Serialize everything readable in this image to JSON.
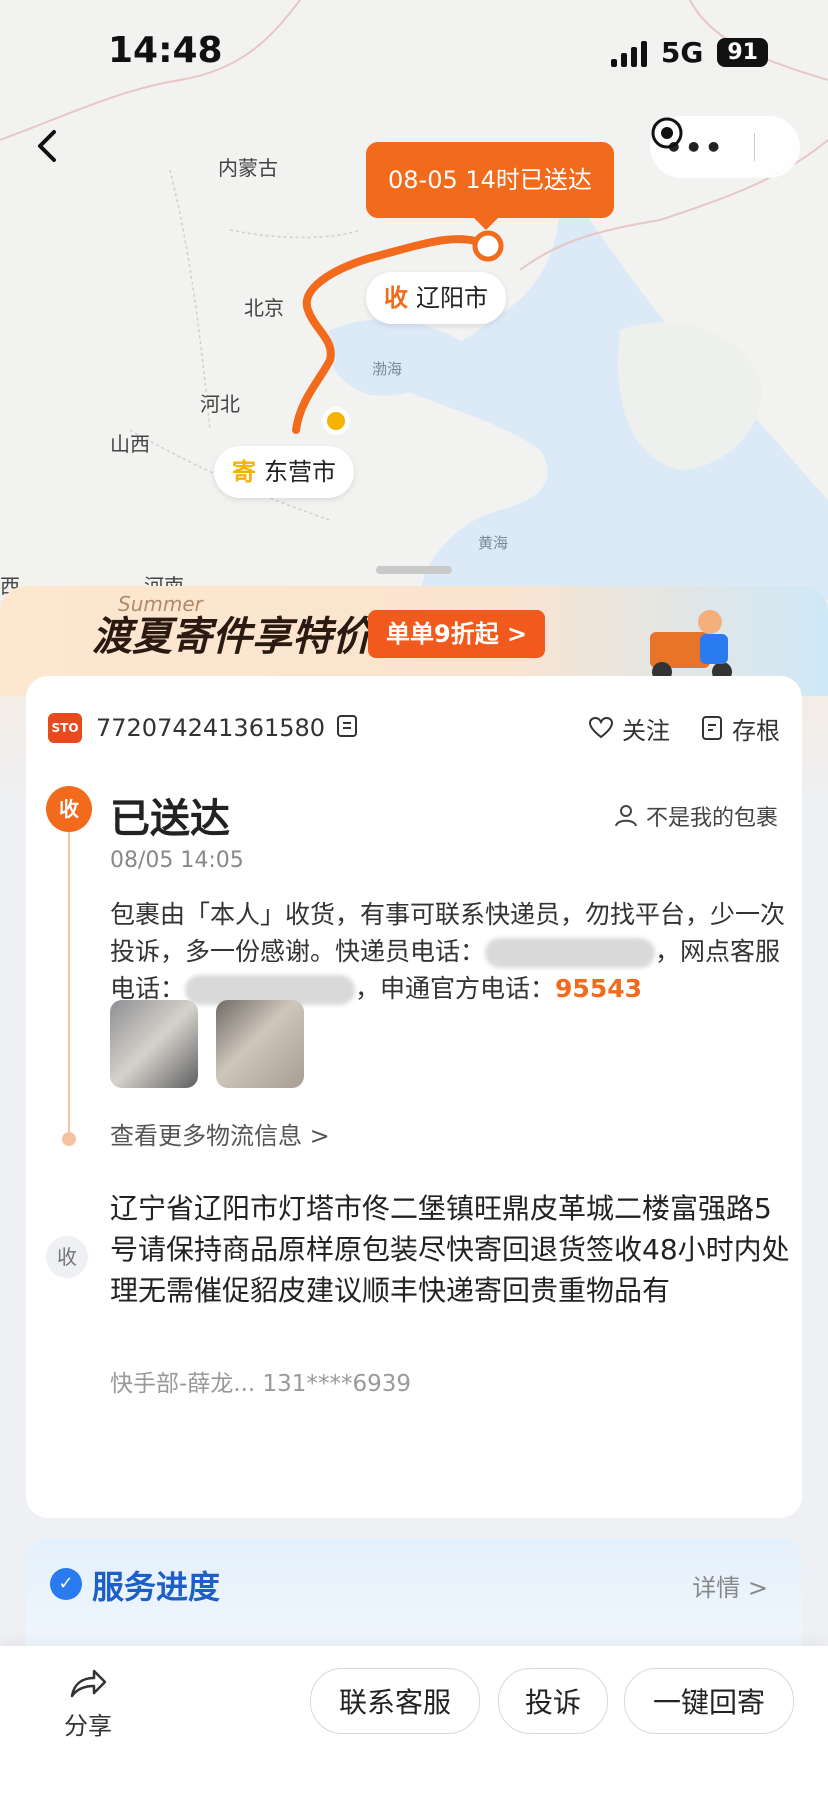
{
  "status_bar": {
    "time": "14:48",
    "network": "5G",
    "battery": "91"
  },
  "map": {
    "labels": [
      "内蒙古",
      "北京",
      "河北",
      "山西",
      "河南",
      "西"
    ],
    "seas": [
      "渤海",
      "黄海"
    ],
    "bubble": "08-05 14时已送达",
    "receive_tag": "收",
    "receive_city": "辽阳市",
    "send_tag": "寄",
    "send_city": "东营市"
  },
  "banner": {
    "text": "渡夏寄件享特价",
    "deco": "Summer",
    "button": "单单9折起 >"
  },
  "package": {
    "carrier_logo": "STO",
    "tracking_number": "772074241361580",
    "follow_label": "关注",
    "stub_label": "存根",
    "status_dot": "收",
    "status": "已送达",
    "not_mine": "不是我的包裹",
    "time": "08/05 14:05",
    "desc_part1": "包裹由「本人」收货，有事可联系快递员，勿找平台，少一次投诉，多一份感谢。快递员电话：",
    "desc_part2": "，网点客服电话：",
    "desc_part3": "，申通官方电话：",
    "hotline": "95543",
    "more_link": "查看更多物流信息 >",
    "addr_dot": "收",
    "address": "辽宁省辽阳市灯塔市佟二堡镇旺鼎皮革城二楼富强路5号请保持商品原样原包装尽快寄回退货签收48小时内处理无需催促貂皮建议顺丰快递寄回贵重物品有",
    "contact": "快手部-薛龙... 131****6939"
  },
  "service": {
    "title": "服务进度",
    "detail": "详情 >"
  },
  "bottom_bar": {
    "share": "分享",
    "contact_service": "联系客服",
    "complain": "投诉",
    "return": "一键回寄"
  }
}
